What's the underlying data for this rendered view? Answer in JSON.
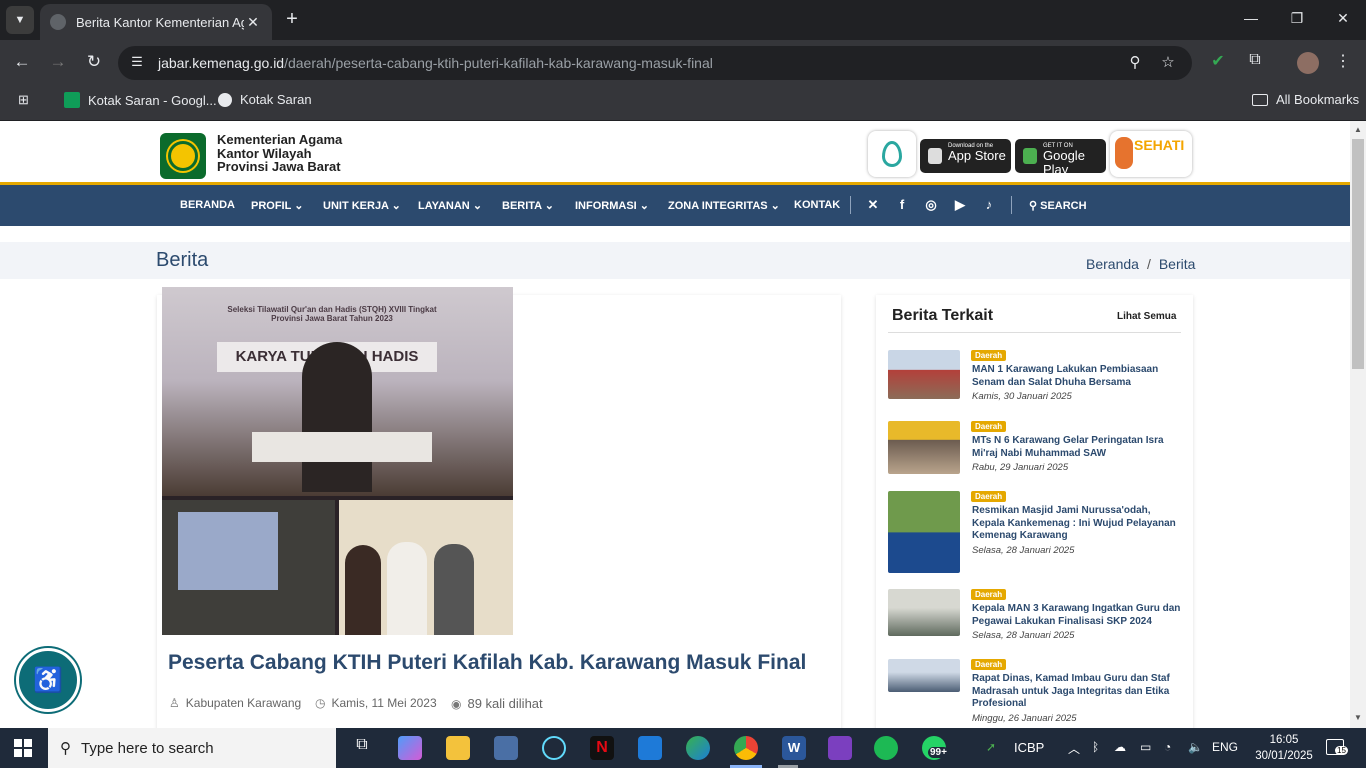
{
  "browser": {
    "tab_title": "Berita Kantor Kementerian Agama Provinsi Jawa Barat",
    "url_domain": "jabar.kemenag.go.id",
    "url_path": "/daerah/peserta-cabang-ktih-puteri-kafilah-kab-karawang-masuk-final",
    "bookmarks": [
      "Kotak Saran - Googl...",
      "Kotak Saran"
    ],
    "all_bookmarks": "All Bookmarks"
  },
  "site": {
    "org_lines": [
      "Kementerian Agama",
      "Kantor Wilayah",
      "Provinsi Jawa Barat"
    ],
    "app_store": {
      "small": "Download on the",
      "big": "App Store"
    },
    "google_play": {
      "small": "GET IT ON",
      "big": "Google Play"
    },
    "sehati": "SEHATI",
    "nav": [
      "BERANDA",
      "PROFIL",
      "UNIT KERJA",
      "LAYANAN",
      "BERITA",
      "INFORMASI",
      "ZONA INTEGRITAS",
      "KONTAK"
    ],
    "search_label": "SEARCH"
  },
  "page": {
    "title": "Berita",
    "breadcrumb": [
      "Beranda",
      "Berita"
    ]
  },
  "article": {
    "photo_caption": "Seleksi Tilawatil Qur'an dan Hadis (STQH) XVIII Tingkat Provinsi Jawa Barat Tahun 2023",
    "banner": "KARYA TULIS I  AH HADIS",
    "title": "Peserta Cabang KTIH Puteri Kafilah Kab. Karawang Masuk Final",
    "author": "Kabupaten Karawang",
    "date": "Kamis, 11 Mei 2023",
    "views": "89 kali dilihat"
  },
  "related": {
    "heading": "Berita Terkait",
    "see_all": "Lihat Semua",
    "items": [
      {
        "category": "Daerah",
        "title": "MAN 1 Karawang Lakukan Pembiasaan Senam dan Salat Dhuha Bersama",
        "date": "Kamis, 30 Januari 2025"
      },
      {
        "category": "Daerah",
        "title": "MTs N 6 Karawang Gelar Peringatan Isra Mi'raj Nabi Muhammad SAW",
        "date": "Rabu, 29 Januari 2025"
      },
      {
        "category": "Daerah",
        "title": "Resmikan Masjid Jami Nurussa'odah, Kepala Kankemenag : Ini Wujud Pelayanan Kemenag Karawang",
        "date": "Selasa, 28 Januari 2025"
      },
      {
        "category": "Daerah",
        "title": "Kepala MAN 3 Karawang Ingatkan Guru dan Pegawai Lakukan Finalisasi SKP 2024",
        "date": "Selasa, 28 Januari 2025"
      },
      {
        "category": "Daerah",
        "title": "Rapat Dinas, Kamad Imbau Guru dan Staf Madrasah untuk Jaga Integritas dan Etika Profesional",
        "date": "Minggu, 26 Januari 2025"
      }
    ]
  },
  "taskbar": {
    "search_placeholder": "Type here to search",
    "whatsapp_badge": "99+",
    "stock": "ICBP",
    "lang": "ENG",
    "time": "16:05",
    "date": "30/01/2025",
    "notifications": "15"
  },
  "colors": {
    "navy": "#2c4a6e",
    "gold": "#e5a800",
    "teal": "#0d6c77"
  }
}
